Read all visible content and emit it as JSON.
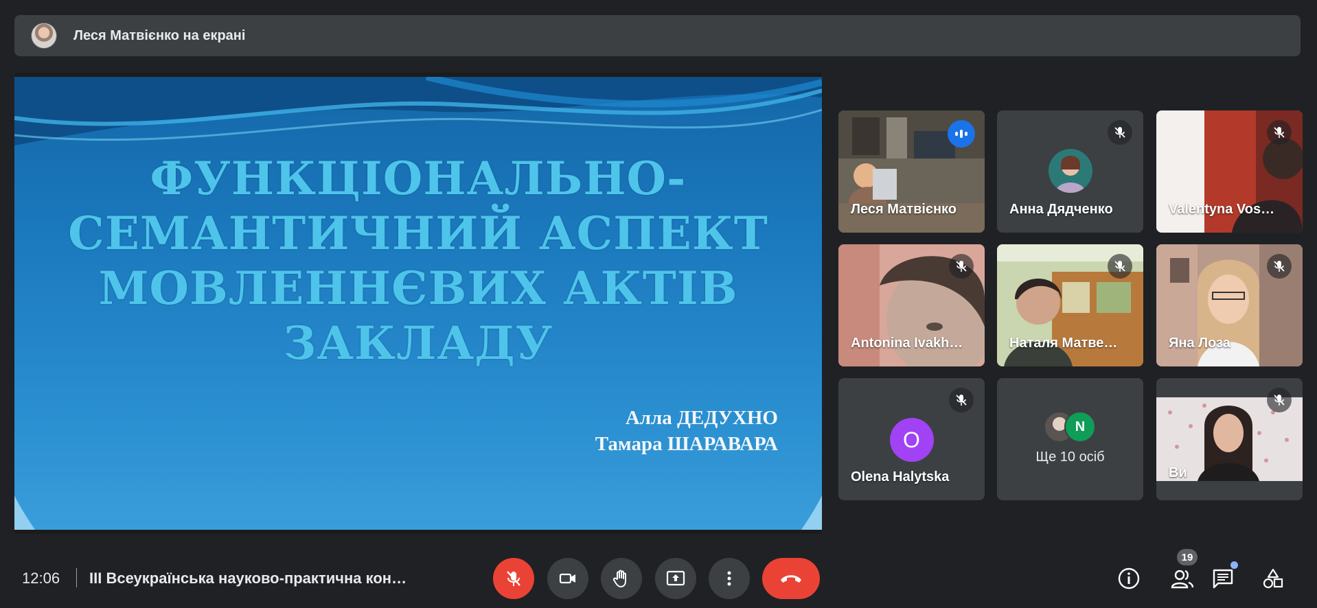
{
  "banner": {
    "presenter_text": "Леся Матвієнко на екрані",
    "avatar_icon": "presenter-avatar"
  },
  "slide": {
    "title_lines": [
      "ФУНКЦІОНАЛЬНО-",
      "СЕМАНТИЧНИЙ АСПЕКТ",
      "МОВЛЕННЄВИХ АКТІВ",
      "ЗАКЛАДУ"
    ],
    "authors": [
      "Алла ДЕДУХНО",
      "Тамара ШАРАВАРА"
    ],
    "colors": {
      "title": "#4ec4ea",
      "background": "#1b79bd"
    }
  },
  "participants": [
    {
      "name": "Леся Матвієнко",
      "state": "speaking"
    },
    {
      "name": "Анна Дядченко",
      "state": "muted"
    },
    {
      "name": "Valentyna Vos…",
      "state": "muted"
    },
    {
      "name": "Antonina Ivakh…",
      "state": "muted"
    },
    {
      "name": "Наталя Матве…",
      "state": "muted"
    },
    {
      "name": "Яна Лоза",
      "state": "muted"
    },
    {
      "name": "Olena Halytska",
      "state": "muted",
      "avatar_letter": "O"
    },
    {
      "name": "Ще 10 осіб",
      "state": "overflow",
      "avatar_letter": "N"
    },
    {
      "name": "Ви",
      "state": "muted"
    }
  ],
  "bottom_bar": {
    "time": "12:06",
    "meeting_title": "III Всеукраїнська науково-практична кон…",
    "controls": [
      "mic-off-icon",
      "camera-icon",
      "raise-hand-icon",
      "present-icon",
      "more-options-icon",
      "end-call-icon"
    ],
    "right_icons": [
      "info-icon",
      "people-icon",
      "chat-icon",
      "activities-icon"
    ],
    "people_count": "19"
  }
}
